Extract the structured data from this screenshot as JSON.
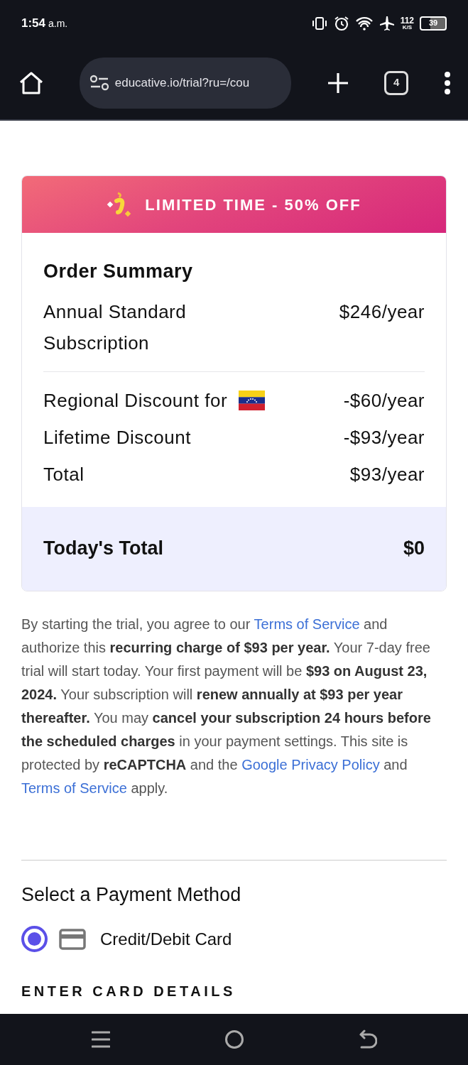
{
  "status_bar": {
    "time": "1:54",
    "meridiem": "a.m.",
    "speed": "112",
    "speed_unit": "K/S",
    "battery": "39"
  },
  "browser": {
    "url": "educative.io/trial?ru=/cou",
    "tab_count": "4"
  },
  "promo": {
    "text": "LIMITED TIME - 50% OFF"
  },
  "order_summary": {
    "title": "Order Summary",
    "lines": [
      {
        "label": "Annual Standard Subscription",
        "amount": "$246/year",
        "flag": false
      },
      {
        "label": "Regional Discount for",
        "amount": "-$60/year",
        "flag": true
      },
      {
        "label": "Lifetime Discount",
        "amount": "-$93/year",
        "flag": false
      },
      {
        "label": "Total",
        "amount": "$93/year",
        "flag": false
      }
    ],
    "today": {
      "label": "Today's Total",
      "amount": "$0"
    }
  },
  "legal": [
    {
      "kind": "plain",
      "text": "By starting the trial, you agree to our "
    },
    {
      "kind": "link",
      "text": "Terms of Service"
    },
    {
      "kind": "plain",
      "text": " and authorize this "
    },
    {
      "kind": "bold",
      "text": "recurring charge of $93 per year."
    },
    {
      "kind": "plain",
      "text": " Your 7-day free trial will start today. Your first payment will be "
    },
    {
      "kind": "bold",
      "text": "$93 on August 23, 2024."
    },
    {
      "kind": "plain",
      "text": " Your subscription will "
    },
    {
      "kind": "bold",
      "text": "renew annually at $93 per year thereafter."
    },
    {
      "kind": "plain",
      "text": " You may "
    },
    {
      "kind": "bold",
      "text": "cancel your subscription 24 hours before the scheduled charges"
    },
    {
      "kind": "plain",
      "text": " in your payment settings. This site is protected by "
    },
    {
      "kind": "bold",
      "text": "reCAPTCHA"
    },
    {
      "kind": "plain",
      "text": " and the "
    },
    {
      "kind": "link",
      "text": "Google Privacy Policy"
    },
    {
      "kind": "plain",
      "text": " and "
    },
    {
      "kind": "link",
      "text": "Terms of Service"
    },
    {
      "kind": "plain",
      "text": " apply."
    }
  ],
  "payment": {
    "title": "Select a Payment Method",
    "methods": [
      {
        "label": "Credit/Debit Card",
        "selected": true
      }
    ],
    "section_label": "ENTER CARD DETAILS"
  }
}
